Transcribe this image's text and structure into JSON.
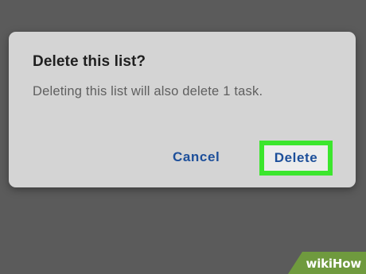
{
  "dialog": {
    "title": "Delete this list?",
    "message": "Deleting this list will also delete 1 task.",
    "cancel_label": "Cancel",
    "delete_label": "Delete"
  },
  "highlight": {
    "color": "#3ce62d",
    "target": "delete-button"
  },
  "watermark": {
    "text_part1": "wiki",
    "text_part2": "How"
  },
  "colors": {
    "backdrop": "#5b5b5b",
    "dialog_background": "#d4d4d4",
    "action_text": "#1d4f9a",
    "title_text": "#1f1f1f",
    "message_text": "#5f5f5f"
  }
}
